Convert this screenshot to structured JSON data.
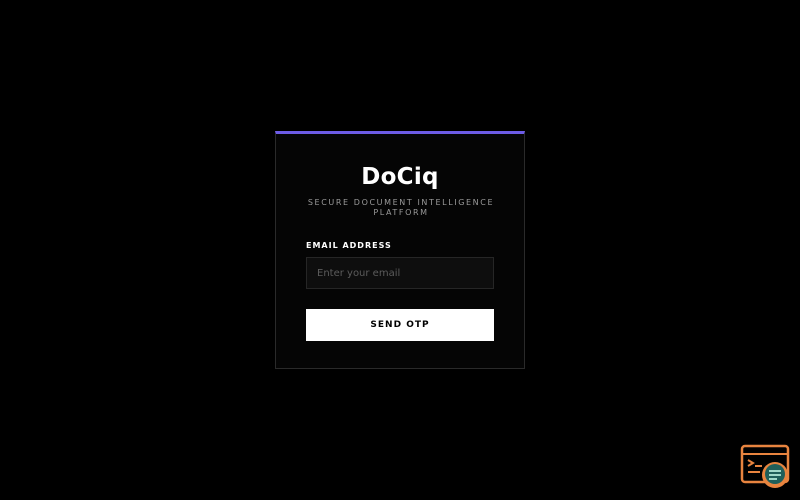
{
  "login": {
    "brand": "DoCiq",
    "tagline": "SECURE DOCUMENT INTELLIGENCE PLATFORM",
    "email_label": "EMAIL ADDRESS",
    "email_placeholder": "Enter your email",
    "email_value": "",
    "send_otp_label": "SEND OTP"
  },
  "colors": {
    "background": "#000000",
    "card_accent": "#6d5ce6",
    "button_bg": "#ffffff",
    "widget_orange": "#e8843f",
    "widget_teal": "#1f5f5a"
  },
  "icons": {
    "floating_widget": "terminal-search-icon"
  }
}
